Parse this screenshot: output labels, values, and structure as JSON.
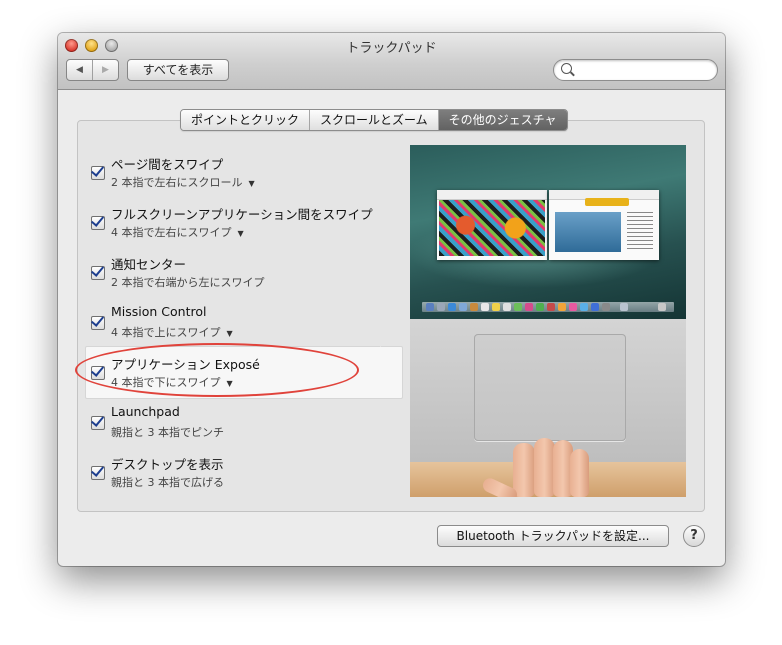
{
  "window": {
    "title": "トラックパッド"
  },
  "toolbar": {
    "back_icon": "◀",
    "forward_icon": "▶",
    "show_all_label": "すべてを表示",
    "search_value": "",
    "search_placeholder": ""
  },
  "tabs": [
    {
      "label": "ポイントとクリック",
      "selected": false
    },
    {
      "label": "スクロールとズーム",
      "selected": false
    },
    {
      "label": "その他のジェスチャ",
      "selected": true
    }
  ],
  "gestures": [
    {
      "title": "ページ間をスワイプ",
      "subtitle": "2 本指で左右にスクロール",
      "checked": true,
      "has_menu": true
    },
    {
      "title": "フルスクリーンアプリケーション間をスワイプ",
      "subtitle": "4 本指で左右にスワイプ",
      "checked": true,
      "has_menu": true
    },
    {
      "title": "通知センター",
      "subtitle": "2 本指で右端から左にスワイプ",
      "checked": true,
      "has_menu": false
    },
    {
      "title": "Mission Control",
      "subtitle": "4 本指で上にスワイプ",
      "checked": true,
      "has_menu": true
    },
    {
      "title": "アプリケーション Exposé",
      "subtitle": "4 本指で下にスワイプ",
      "checked": true,
      "has_menu": true,
      "highlighted": true
    },
    {
      "title": "Launchpad",
      "subtitle": "親指と 3 本指でピンチ",
      "checked": true,
      "has_menu": false
    },
    {
      "title": "デスクトップを表示",
      "subtitle": "親指と 3 本指で広げる",
      "checked": true,
      "has_menu": false
    }
  ],
  "menu_arrow": "▼",
  "preview": {
    "thumb1_caption": "",
    "thumb2_caption": ""
  },
  "footer": {
    "bluetooth_button": "Bluetooth トラックパッドを設定...",
    "help_button": "?"
  },
  "colors": {
    "highlight_ring": "#e0433b",
    "checkmark": "#1d3e8f",
    "active_tab": "#6e6e6e"
  }
}
